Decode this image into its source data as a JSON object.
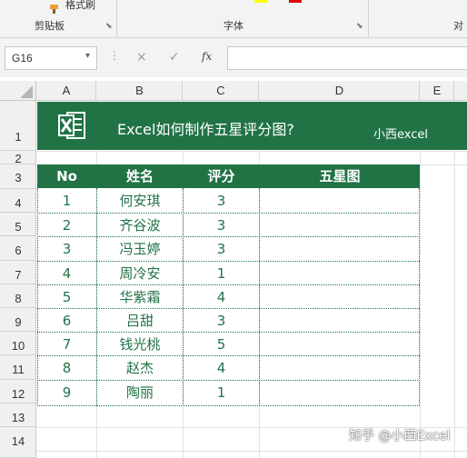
{
  "ribbon": {
    "format_painter_label": "格式刷",
    "group_clipboard": "剪贴板",
    "group_font": "字体",
    "group_align_partial": "对"
  },
  "formula_bar": {
    "name_box_value": "G16",
    "fx_label": "fx",
    "cancel_icon": "×",
    "enter_icon": "✓",
    "formula_value": ""
  },
  "columns": [
    "A",
    "B",
    "C",
    "D",
    "E"
  ],
  "rows": [
    "1",
    "2",
    "3",
    "4",
    "5",
    "6",
    "7",
    "8",
    "9",
    "10",
    "11",
    "12",
    "13",
    "14"
  ],
  "banner": {
    "title": "Excel如何制作五星评分图?",
    "brand": "小西excel",
    "bg_color": "#217346"
  },
  "table": {
    "headers": [
      "No",
      "姓名",
      "评分",
      "五星图"
    ],
    "rows": [
      {
        "no": "1",
        "name": "何安琪",
        "score": "3",
        "stars": ""
      },
      {
        "no": "2",
        "name": "齐谷波",
        "score": "3",
        "stars": ""
      },
      {
        "no": "3",
        "name": "冯玉婷",
        "score": "3",
        "stars": ""
      },
      {
        "no": "4",
        "name": "周冷安",
        "score": "1",
        "stars": ""
      },
      {
        "no": "5",
        "name": "华紫霜",
        "score": "4",
        "stars": ""
      },
      {
        "no": "6",
        "name": "吕甜",
        "score": "3",
        "stars": ""
      },
      {
        "no": "7",
        "name": "钱光桃",
        "score": "5",
        "stars": ""
      },
      {
        "no": "8",
        "name": "赵杰",
        "score": "4",
        "stars": ""
      },
      {
        "no": "9",
        "name": "陶丽",
        "score": "1",
        "stars": ""
      }
    ],
    "accent_color": "#217346"
  },
  "watermark": "知乎 @小西Excel"
}
